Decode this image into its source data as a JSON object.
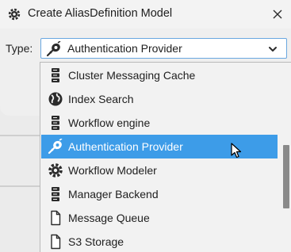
{
  "window": {
    "title": "Create AliasDefinition Model",
    "icon": "gear-icon",
    "close_icon": "close-icon"
  },
  "form": {
    "type_label": "Type:",
    "type_value": "Authentication Provider",
    "type_icon": "guitar-key-icon"
  },
  "dropdown": {
    "items": [
      {
        "label": "Cluster Messaging Cache",
        "icon": "server-stack-icon",
        "selected": false
      },
      {
        "label": "Index Search",
        "icon": "globe-icon",
        "selected": false
      },
      {
        "label": "Workflow engine",
        "icon": "server-stack-icon",
        "selected": false
      },
      {
        "label": "Authentication Provider",
        "icon": "guitar-key-icon",
        "selected": true
      },
      {
        "label": "Workflow Modeler",
        "icon": "gear-icon",
        "selected": false
      },
      {
        "label": "Manager Backend",
        "icon": "server-stack-icon",
        "selected": false
      },
      {
        "label": "Message Queue",
        "icon": "document-icon",
        "selected": false
      },
      {
        "label": "S3 Storage",
        "icon": "document-icon",
        "selected": false
      }
    ],
    "selected_color": "#3d9ce8"
  }
}
